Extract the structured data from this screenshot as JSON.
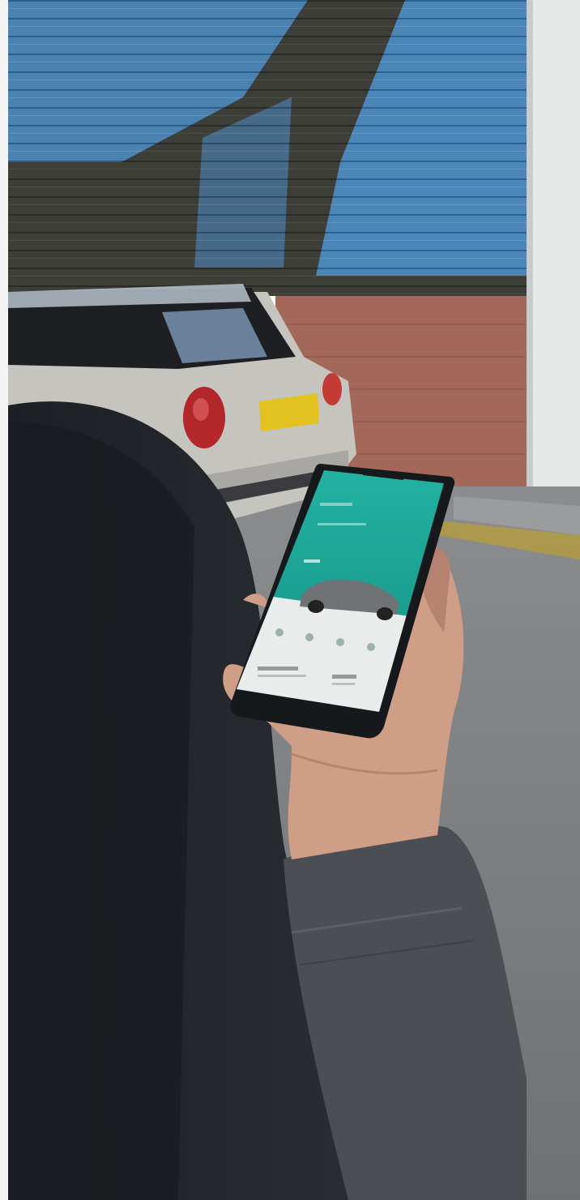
{
  "scene": {
    "description_visible_text": [],
    "colors": {
      "shutter_blue": "#4d8fc6",
      "shutter_dark": "#3f3f3a",
      "brick": "#a4685a",
      "pillar": "#e6e8e8",
      "road": "#7b7d7f",
      "car_silver": "#c6c4bf",
      "tail_light": "#b3262a",
      "plate_yellow": "#e2c21f",
      "phone_screen_teal": "#1aa597",
      "coat_dark": "#2a2d31",
      "sleeve_grey": "#4b4e52",
      "skin": "#cf9e87"
    },
    "icons": [
      "phone",
      "car",
      "hand"
    ]
  }
}
